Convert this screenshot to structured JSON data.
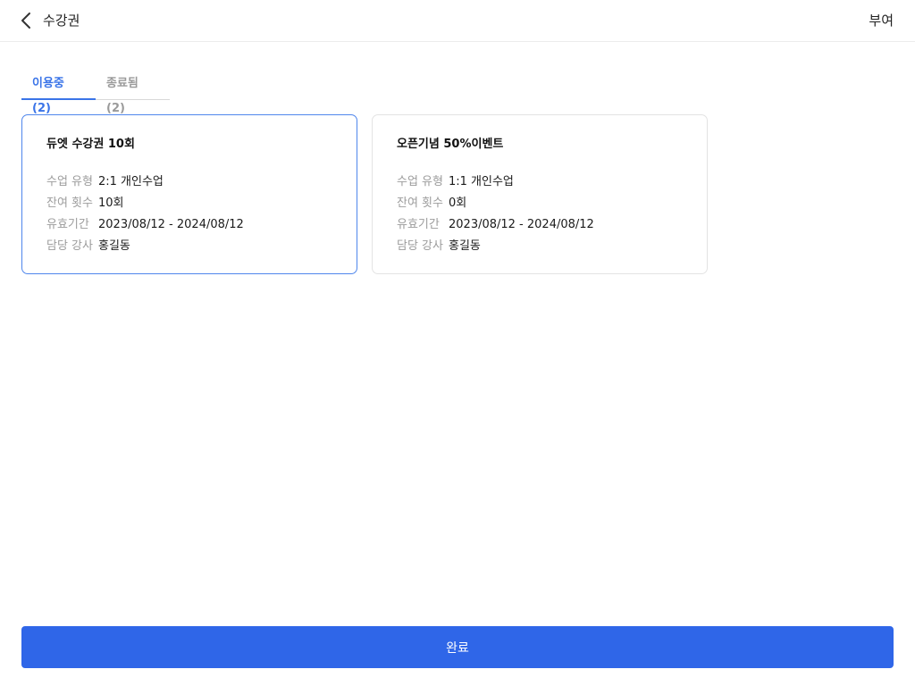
{
  "header": {
    "title": "수강권",
    "action_label": "부여",
    "back_icon": "chevron-left-icon"
  },
  "tabs": [
    {
      "label": "이용중 (2)",
      "active": true
    },
    {
      "label": "종료됨 (2)",
      "active": false
    }
  ],
  "cards": [
    {
      "title": "듀엣 수강권 10회",
      "selected": true,
      "rows": [
        {
          "label": "수업 유형",
          "value": "2:1 개인수업"
        },
        {
          "label": "잔여 횟수",
          "value": "10회"
        },
        {
          "label": "유효기간",
          "value": "2023/08/12 - 2024/08/12"
        },
        {
          "label": "담당 강사",
          "value": "홍길동"
        }
      ]
    },
    {
      "title": "오픈기념 50%이벤트",
      "selected": false,
      "rows": [
        {
          "label": "수업 유형",
          "value": "1:1 개인수업"
        },
        {
          "label": "잔여 횟수",
          "value": "0회"
        },
        {
          "label": "유효기간",
          "value": "2023/08/12 - 2024/08/12"
        },
        {
          "label": "담당 강사",
          "value": "홍길동"
        }
      ]
    }
  ],
  "footer": {
    "complete_label": "완료"
  },
  "colors": {
    "accent": "#3a74e8",
    "button": "#2f66e8",
    "selected_border": "#4f86ec",
    "label_gray": "#9c9c9c"
  }
}
